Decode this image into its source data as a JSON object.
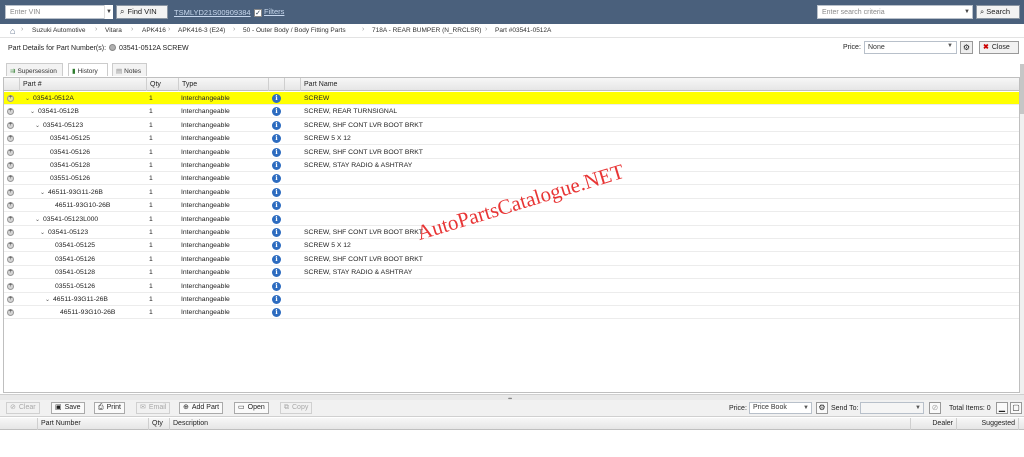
{
  "topbar": {
    "vin_placeholder": "Enter VIN",
    "find_vin_label": "Find VIN",
    "vin_value": "TSMLYD21S00909384",
    "filters_label": "Filters",
    "filters_checked": true,
    "search_placeholder": "Enter search criteria",
    "search_label": "Search"
  },
  "breadcrumb": {
    "items": [
      "Suzuki Automotive",
      "Vitara",
      "APK416",
      "APK416-3 (E24)",
      "50 - Outer Body / Body Fitting Parts",
      "718A - REAR BUMPER (N_RRCLSR)",
      "Part #03541-0512A"
    ]
  },
  "details": {
    "title_prefix": "Part Details for Part Number(s):",
    "title_part": "03541-0512A SCREW",
    "price_label": "Price:",
    "price_value": "None",
    "close_label": "Close"
  },
  "tabs": [
    {
      "label": "Supersession",
      "icon": "supersession-icon"
    },
    {
      "label": "History",
      "icon": "history-icon"
    },
    {
      "label": "Notes",
      "icon": "notes-icon"
    }
  ],
  "grid": {
    "columns": [
      "Part #",
      "Qty",
      "Type",
      "",
      "",
      "Part Name"
    ],
    "rows": [
      {
        "part": "03541-0512A",
        "qty": "1",
        "type": "Interchangeable",
        "name": "SCREW",
        "level": 0,
        "expand": true,
        "selected": true
      },
      {
        "part": "03541-0512B",
        "qty": "1",
        "type": "Interchangeable",
        "name": "SCREW, REAR TURNSIGNAL",
        "level": 1,
        "expand": true
      },
      {
        "part": "03541-05123",
        "qty": "1",
        "type": "Interchangeable",
        "name": "SCREW, SHF CONT LVR BOOT BRKT",
        "level": 2,
        "expand": true
      },
      {
        "part": "03541-05125",
        "qty": "1",
        "type": "Interchangeable",
        "name": "SCREW 5 X 12",
        "level": 3,
        "expand": false
      },
      {
        "part": "03541-05126",
        "qty": "1",
        "type": "Interchangeable",
        "name": "SCREW, SHF CONT LVR BOOT BRKT",
        "level": 3,
        "expand": false
      },
      {
        "part": "03541-05128",
        "qty": "1",
        "type": "Interchangeable",
        "name": "SCREW, STAY RADIO & ASHTRAY",
        "level": 3,
        "expand": false
      },
      {
        "part": "03551-05126",
        "qty": "1",
        "type": "Interchangeable",
        "name": "",
        "level": 3,
        "expand": false
      },
      {
        "part": "46511-93G11-26B",
        "qty": "1",
        "type": "Interchangeable",
        "name": "",
        "level": 3,
        "expand": true
      },
      {
        "part": "46511-93G10-26B",
        "qty": "1",
        "type": "Interchangeable",
        "name": "",
        "level": 4,
        "expand": false
      },
      {
        "part": "03541-05123L000",
        "qty": "1",
        "type": "Interchangeable",
        "name": "",
        "level": 2,
        "expand": true
      },
      {
        "part": "03541-05123",
        "qty": "1",
        "type": "Interchangeable",
        "name": "SCREW, SHF CONT LVR BOOT BRKT",
        "level": 3,
        "expand": true
      },
      {
        "part": "03541-05125",
        "qty": "1",
        "type": "Interchangeable",
        "name": "SCREW 5 X 12",
        "level": 4,
        "expand": false
      },
      {
        "part": "03541-05126",
        "qty": "1",
        "type": "Interchangeable",
        "name": "SCREW, SHF CONT LVR BOOT BRKT",
        "level": 4,
        "expand": false
      },
      {
        "part": "03541-05128",
        "qty": "1",
        "type": "Interchangeable",
        "name": "SCREW, STAY RADIO & ASHTRAY",
        "level": 4,
        "expand": false
      },
      {
        "part": "03551-05126",
        "qty": "1",
        "type": "Interchangeable",
        "name": "",
        "level": 4,
        "expand": false
      },
      {
        "part": "46511-93G11-26B",
        "qty": "1",
        "type": "Interchangeable",
        "name": "",
        "level": 4,
        "expand": true
      },
      {
        "part": "46511-93G10-26B",
        "qty": "1",
        "type": "Interchangeable",
        "name": "",
        "level": 5,
        "expand": false
      }
    ]
  },
  "watermark": "AutoPartsCatalogue.NET",
  "toolbar": {
    "clear_label": "Clear",
    "save_label": "Save",
    "print_label": "Print",
    "email_label": "Email",
    "add_part_label": "Add Part",
    "open_label": "Open",
    "copy_label": "Copy",
    "price_label": "Price:",
    "price_value": "Price Book",
    "send_to_label": "Send To:",
    "send_to_value": "",
    "total_items_label": "Total Items: 0"
  },
  "bottom_grid": {
    "columns": [
      "Part Number",
      "Qty",
      "Description",
      "Dealer",
      "Suggested"
    ]
  },
  "colors": {
    "topbar": "#4a607c",
    "selected_row": "#ffff00",
    "info_icon": "#2d6cc0",
    "watermark": "#e62020"
  }
}
